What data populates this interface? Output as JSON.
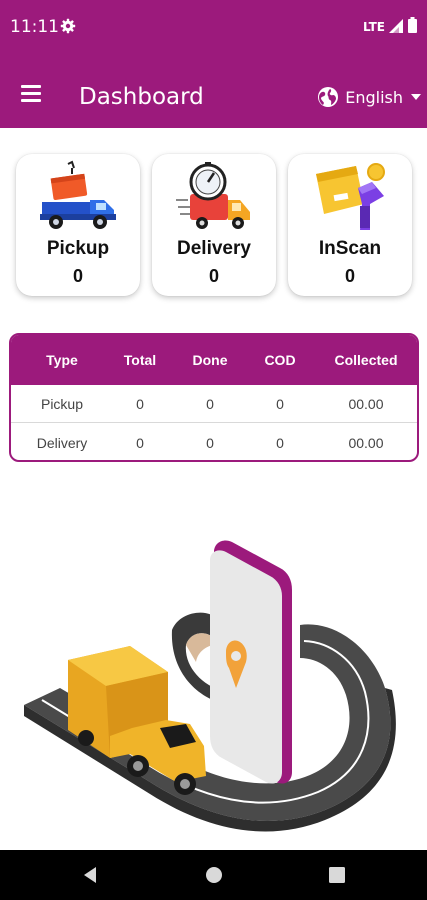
{
  "status_bar": {
    "time": "11:11",
    "network": "LTE"
  },
  "app_bar": {
    "title": "Dashboard",
    "language": "English"
  },
  "cards": [
    {
      "label": "Pickup",
      "count": "0"
    },
    {
      "label": "Delivery",
      "count": "0"
    },
    {
      "label": "InScan",
      "count": "0"
    }
  ],
  "summary_table": {
    "headers": [
      "Type",
      "Total",
      "Done",
      "COD",
      "Collected"
    ],
    "rows": [
      [
        "Pickup",
        "0",
        "0",
        "0",
        "00.00"
      ],
      [
        "Delivery",
        "0",
        "0",
        "0",
        "00.00"
      ]
    ]
  },
  "colors": {
    "primary": "#9c1a7c",
    "road": "#444444",
    "truck": "#f2b630"
  },
  "icons": [
    "settings-icon",
    "signal-icon",
    "battery-icon",
    "menu-icon",
    "globe-icon",
    "dropdown-caret-icon",
    "back-icon",
    "home-icon",
    "recents-icon"
  ]
}
